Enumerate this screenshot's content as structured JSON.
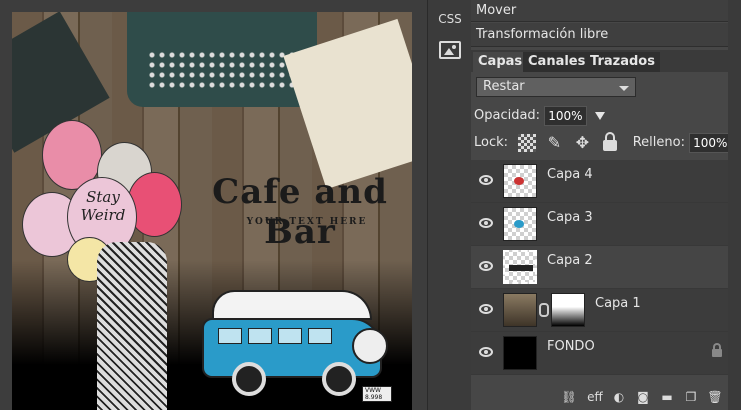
{
  "canvas": {
    "artwork_title": "Cafe and Bar",
    "artwork_tagline": "YOUR TEXT HERE",
    "balloon_text": "Stay Weird",
    "van_plate": "VWW 8.998"
  },
  "toolstrip": {
    "css_label": "CSS",
    "image_icon": "image-icon"
  },
  "panel": {
    "menu": [
      "Mover",
      "Transformación libre"
    ],
    "tabs": [
      "Capas",
      "Canales",
      "Trazados"
    ],
    "blend_mode": "Restar",
    "opacity_label": "Opacidad:",
    "opacity_value": "100%",
    "lock_label": "Lock:",
    "fill_label": "Relleno:",
    "fill_value": "100%",
    "layers": [
      {
        "name": "Capa 4"
      },
      {
        "name": "Capa 3"
      },
      {
        "name": "Capa 2"
      },
      {
        "name": "Capa 1"
      },
      {
        "name": "FONDO"
      }
    ],
    "bottom_icons": [
      "link-icon",
      "eff",
      "adjustment-icon",
      "mask-icon",
      "folder-icon",
      "new-layer-icon",
      "trash-icon"
    ],
    "eff_label": "eff"
  }
}
